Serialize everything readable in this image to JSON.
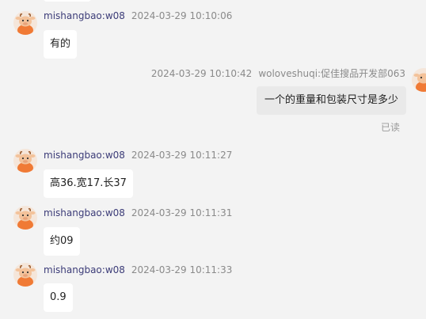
{
  "messages": [
    {
      "direction": "in",
      "sender": "mishangbao:w08",
      "time": "2024-03-29 10:10:06",
      "text": "有的"
    },
    {
      "direction": "out",
      "sender": "woloveshuqi:促佳搜品开发部063",
      "time": "2024-03-29 10:10:42",
      "text": "一个的重量和包装尺寸是多少",
      "status": "已读"
    },
    {
      "direction": "in",
      "sender": "mishangbao:w08",
      "time": "2024-03-29 10:11:27",
      "text": "高36.宽17.长37"
    },
    {
      "direction": "in",
      "sender": "mishangbao:w08",
      "time": "2024-03-29 10:11:31",
      "text": "约09"
    },
    {
      "direction": "in",
      "sender": "mishangbao:w08",
      "time": "2024-03-29 10:11:33",
      "text": "0.9"
    }
  ],
  "icons": {
    "avatar": "cartoon-cow-avatar-icon"
  },
  "colors": {
    "background": "#f3f3f3",
    "sender_name": "#3c3c78",
    "timestamp": "#8a8a8a",
    "incoming_bubble": "#ffffff",
    "outgoing_bubble": "#e9e9e9",
    "avatar_orange": "#f07a35"
  }
}
